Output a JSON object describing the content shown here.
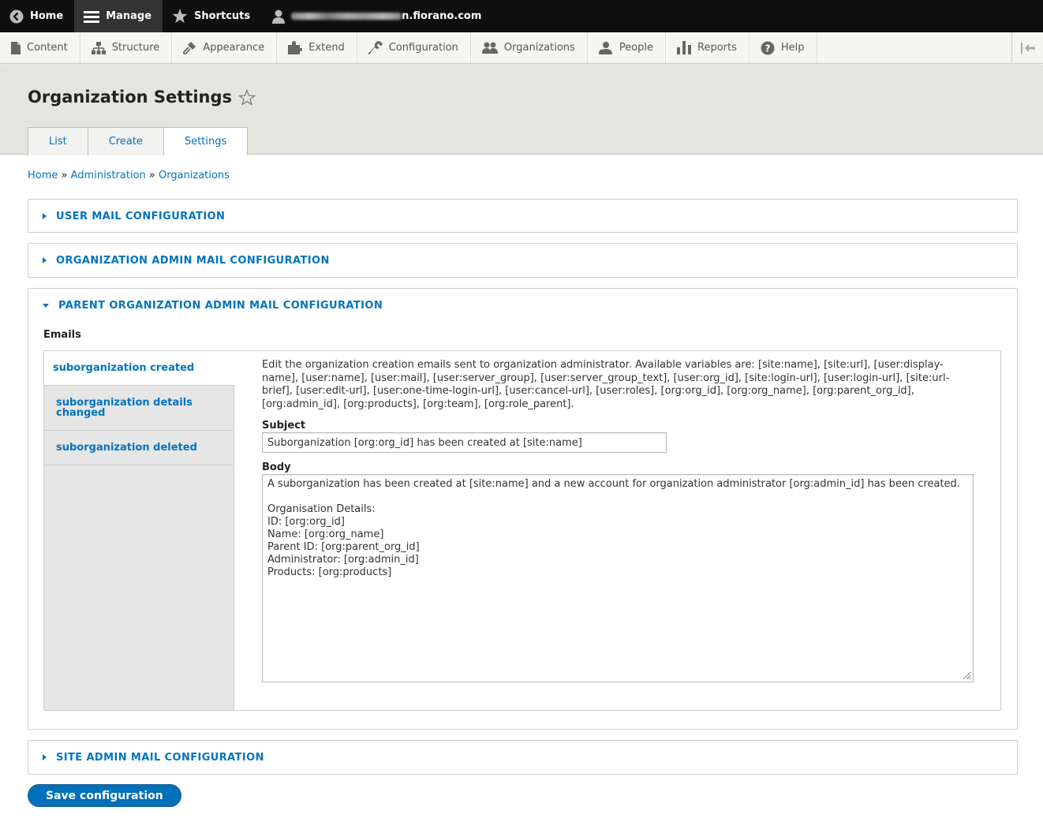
{
  "toolbar": {
    "home": "Home",
    "manage": "Manage",
    "shortcuts": "Shortcuts",
    "user_domain": "n.fiorano.com"
  },
  "tray": {
    "items": [
      "Content",
      "Structure",
      "Appearance",
      "Extend",
      "Configuration",
      "Organizations",
      "People",
      "Reports",
      "Help"
    ]
  },
  "page": {
    "title": "Organization Settings",
    "tabs": [
      "List",
      "Create",
      "Settings"
    ],
    "active_tab": "Settings"
  },
  "breadcrumb": {
    "items": [
      "Home",
      "Administration",
      "Organizations"
    ],
    "separator": "»"
  },
  "sections": {
    "user_mail": "USER MAIL CONFIGURATION",
    "org_admin_mail": "ORGANIZATION ADMIN MAIL CONFIGURATION",
    "parent_org_admin_mail": "PARENT ORGANIZATION ADMIN MAIL CONFIGURATION",
    "site_admin_mail": "SITE ADMIN MAIL CONFIGURATION"
  },
  "emails": {
    "label": "Emails",
    "vtabs": [
      "suborganization created",
      "suborganization details changed",
      "suborganization deleted"
    ],
    "description": "Edit the organization creation emails sent to organization administrator. Available variables are: [site:name], [site:url], [user:display-name], [user:name], [user:mail], [user:server_group], [user:server_group_text], [user:org_id], [site:login-url], [user:login-url], [site:url-brief], [user:edit-url], [user:one-time-login-url], [user:cancel-url], [user:roles], [org:org_id], [org:org_name], [org:parent_org_id], [org:admin_id], [org:products], [org:team], [org:role_parent].",
    "subject_label": "Subject",
    "subject_value": "Suborganization [org:org_id] has been created at [site:name]",
    "body_label": "Body",
    "body_value": "A suborganization has been created at [site:name] and a new account for organization administrator [org:admin_id] has been created.\n\nOrganisation Details:\nID: [org:org_id]\nName: [org:org_name]\nParent ID: [org:parent_org_id]\nAdministrator: [org:admin_id]\nProducts: [org:products]"
  },
  "actions": {
    "save": "Save configuration"
  },
  "colors": {
    "link": "#0074bd",
    "toolbar_bg": "#0f0f0f",
    "button_bg": "#0071b8"
  }
}
